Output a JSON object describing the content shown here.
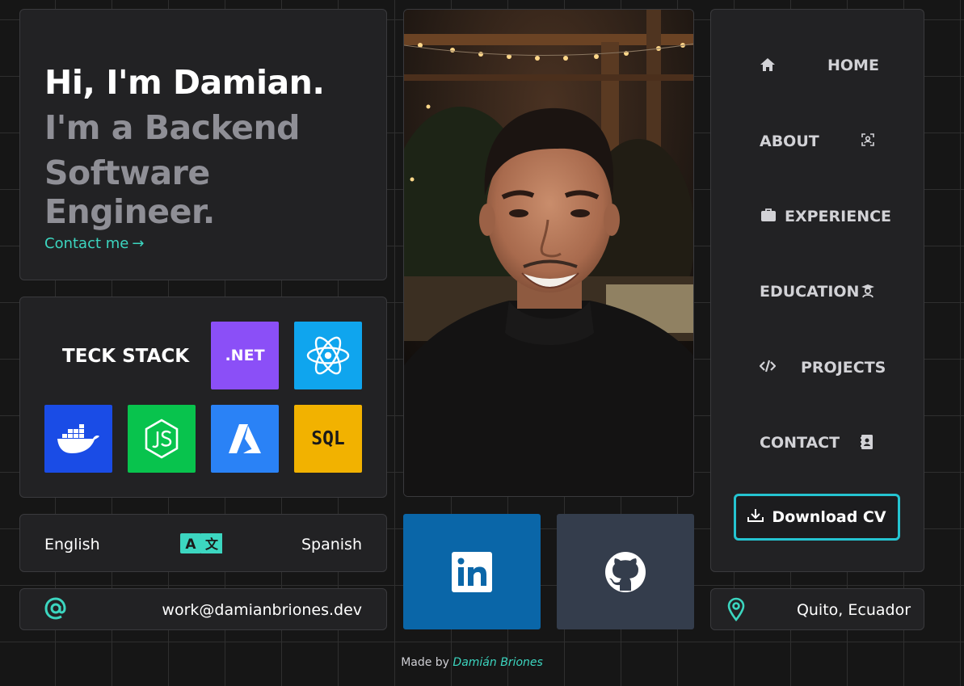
{
  "intro": {
    "greeting": "Hi, I'm Damian.",
    "role_line1": "I'm a Backend",
    "role_line2": "Software Engineer.",
    "contact_link": "Contact me",
    "contact_arrow": "→"
  },
  "stack": {
    "title": "TECK STACK",
    "tiles": [
      {
        "label": ".NET",
        "icon": "dotnet-icon",
        "color": "#8b4ff7"
      },
      {
        "label": "",
        "icon": "react-icon",
        "color": "#0fa5ee"
      },
      {
        "label": "",
        "icon": "docker-icon",
        "color": "#1a4ce6"
      },
      {
        "label": "",
        "icon": "nodejs-icon",
        "color": "#08c34d"
      },
      {
        "label": "",
        "icon": "azure-icon",
        "color": "#2a82f6"
      },
      {
        "label": "SQL",
        "icon": "sql-icon",
        "color": "#f2b200"
      }
    ]
  },
  "language": {
    "left": "English",
    "right": "Spanish",
    "icon": "translate-icon"
  },
  "email": {
    "icon": "at-icon",
    "address": "work@damianbriones.dev"
  },
  "socials": {
    "linkedin_icon": "linkedin-icon",
    "github_icon": "github-icon",
    "linkedin_color": "#0a66a8",
    "github_color": "#343d4c"
  },
  "nav": {
    "items": [
      {
        "label": "HOME",
        "icon": "home-icon"
      },
      {
        "label": "ABOUT",
        "icon": "user-scan-icon"
      },
      {
        "label": "EXPERIENCE",
        "icon": "briefcase-icon"
      },
      {
        "label": "EDUCATION",
        "icon": "graduate-icon"
      },
      {
        "label": "PROJECTS",
        "icon": "code-icon"
      },
      {
        "label": "CONTACT",
        "icon": "address-book-icon"
      }
    ],
    "download_cv": "Download CV"
  },
  "location": {
    "icon": "map-pin-icon",
    "text": "Quito, Ecuador"
  },
  "footer": {
    "prefix": "Made by",
    "author": "Damián Briones"
  },
  "colors": {
    "accent": "#3cd6c0",
    "cv_border": "#25c4d1",
    "card_bg": "#222224",
    "page_bg": "#161616"
  }
}
